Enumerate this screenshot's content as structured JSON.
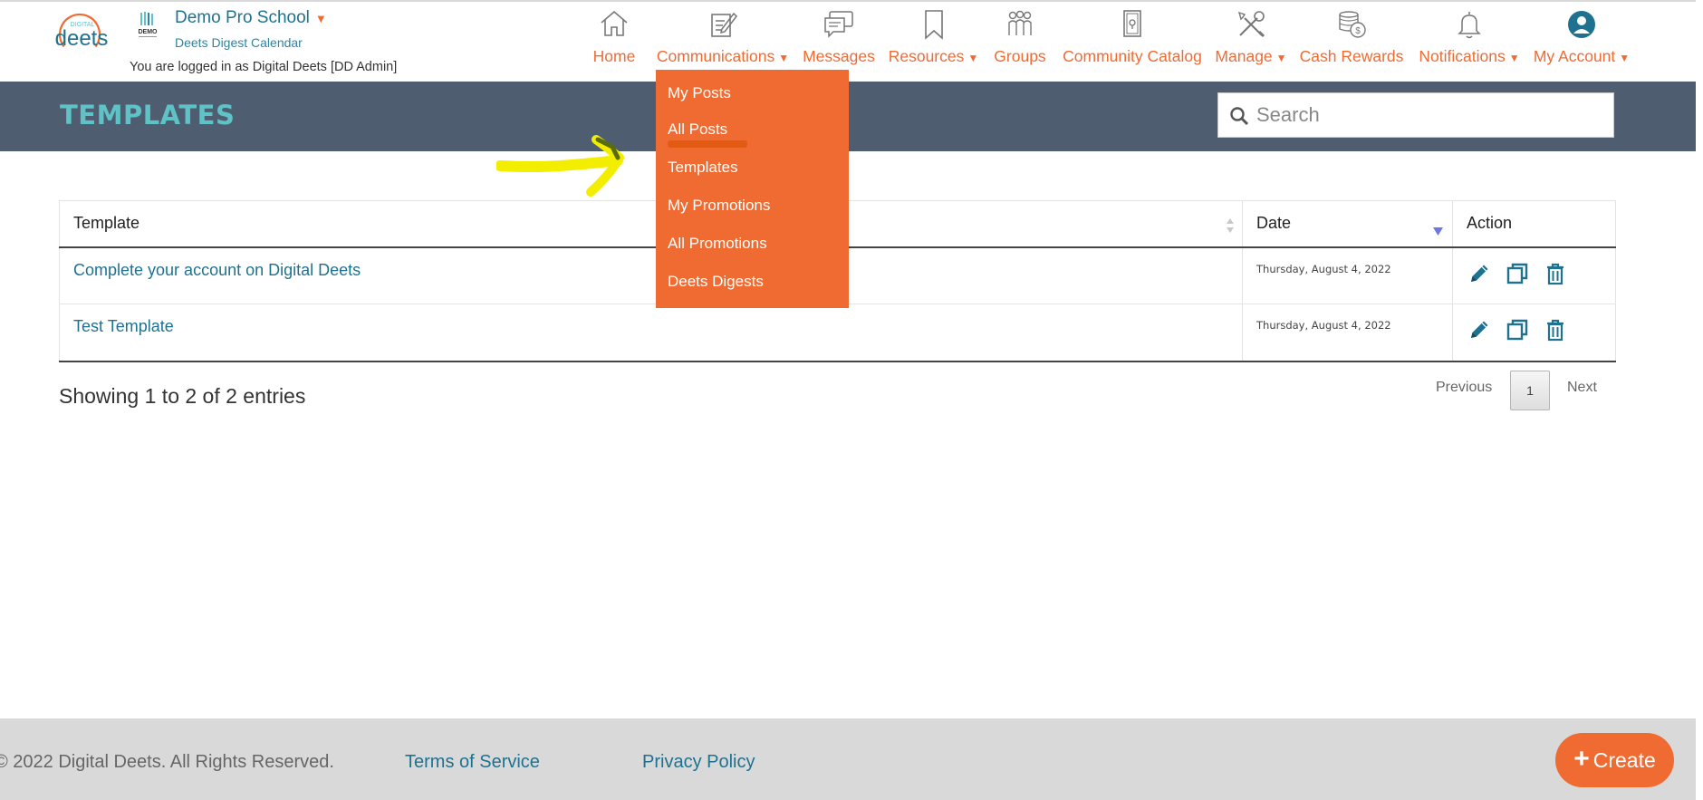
{
  "header": {
    "logo_text": "deets",
    "logo_small": "DIGITAL",
    "emblem_text": "DEMO",
    "school_name": "Demo Pro School",
    "school_caret": "▼",
    "school_sub": "Deets Digest Calendar",
    "logged_in": "You are logged in as Digital Deets [DD Admin]"
  },
  "nav": {
    "caret": "▼",
    "items": [
      {
        "label": "Home",
        "icon": "home-icon"
      },
      {
        "label": "Communications",
        "icon": "compose-icon",
        "has_caret": true
      },
      {
        "label": "Messages",
        "icon": "chat-icon"
      },
      {
        "label": "Resources",
        "icon": "bookmark-icon",
        "has_caret": true
      },
      {
        "label": "Groups",
        "icon": "groups-icon"
      },
      {
        "label": "Community Catalog",
        "icon": "catalog-icon"
      },
      {
        "label": "Manage",
        "icon": "tools-icon",
        "has_caret": true
      },
      {
        "label": "Cash Rewards",
        "icon": "coins-icon"
      },
      {
        "label": "Notifications",
        "icon": "bell-icon",
        "has_caret": true
      },
      {
        "label": "My Account",
        "icon": "account-icon",
        "has_caret": true
      }
    ]
  },
  "communications_menu": {
    "items": [
      "My Posts",
      "All Posts",
      "Templates",
      "My Promotions",
      "All Promotions",
      "Deets Digests"
    ]
  },
  "page": {
    "title": "TEMPLATES",
    "search_placeholder": "Search"
  },
  "table": {
    "columns": [
      "Template",
      "Date",
      "Action"
    ],
    "rows": [
      {
        "template": "Complete your account on Digital Deets",
        "date": "Thursday, August 4, 2022"
      },
      {
        "template": "Test Template",
        "date": "Thursday, August 4, 2022"
      }
    ]
  },
  "pagination": {
    "info": "Showing 1 to 2 of 2 entries",
    "previous": "Previous",
    "current": "1",
    "next": "Next"
  },
  "footer": {
    "copyright": "© 2022 Digital Deets. All Rights Reserved.",
    "terms": "Terms of Service",
    "privacy": "Privacy Policy",
    "create_plus": "+",
    "create_label": "Create"
  },
  "colors": {
    "accent_orange": "#ef6b32",
    "teal_title": "#5ec2c6",
    "link_blue": "#1e7290",
    "title_bar": "#4e5e70",
    "annotation_yellow": "#f3ee00"
  }
}
